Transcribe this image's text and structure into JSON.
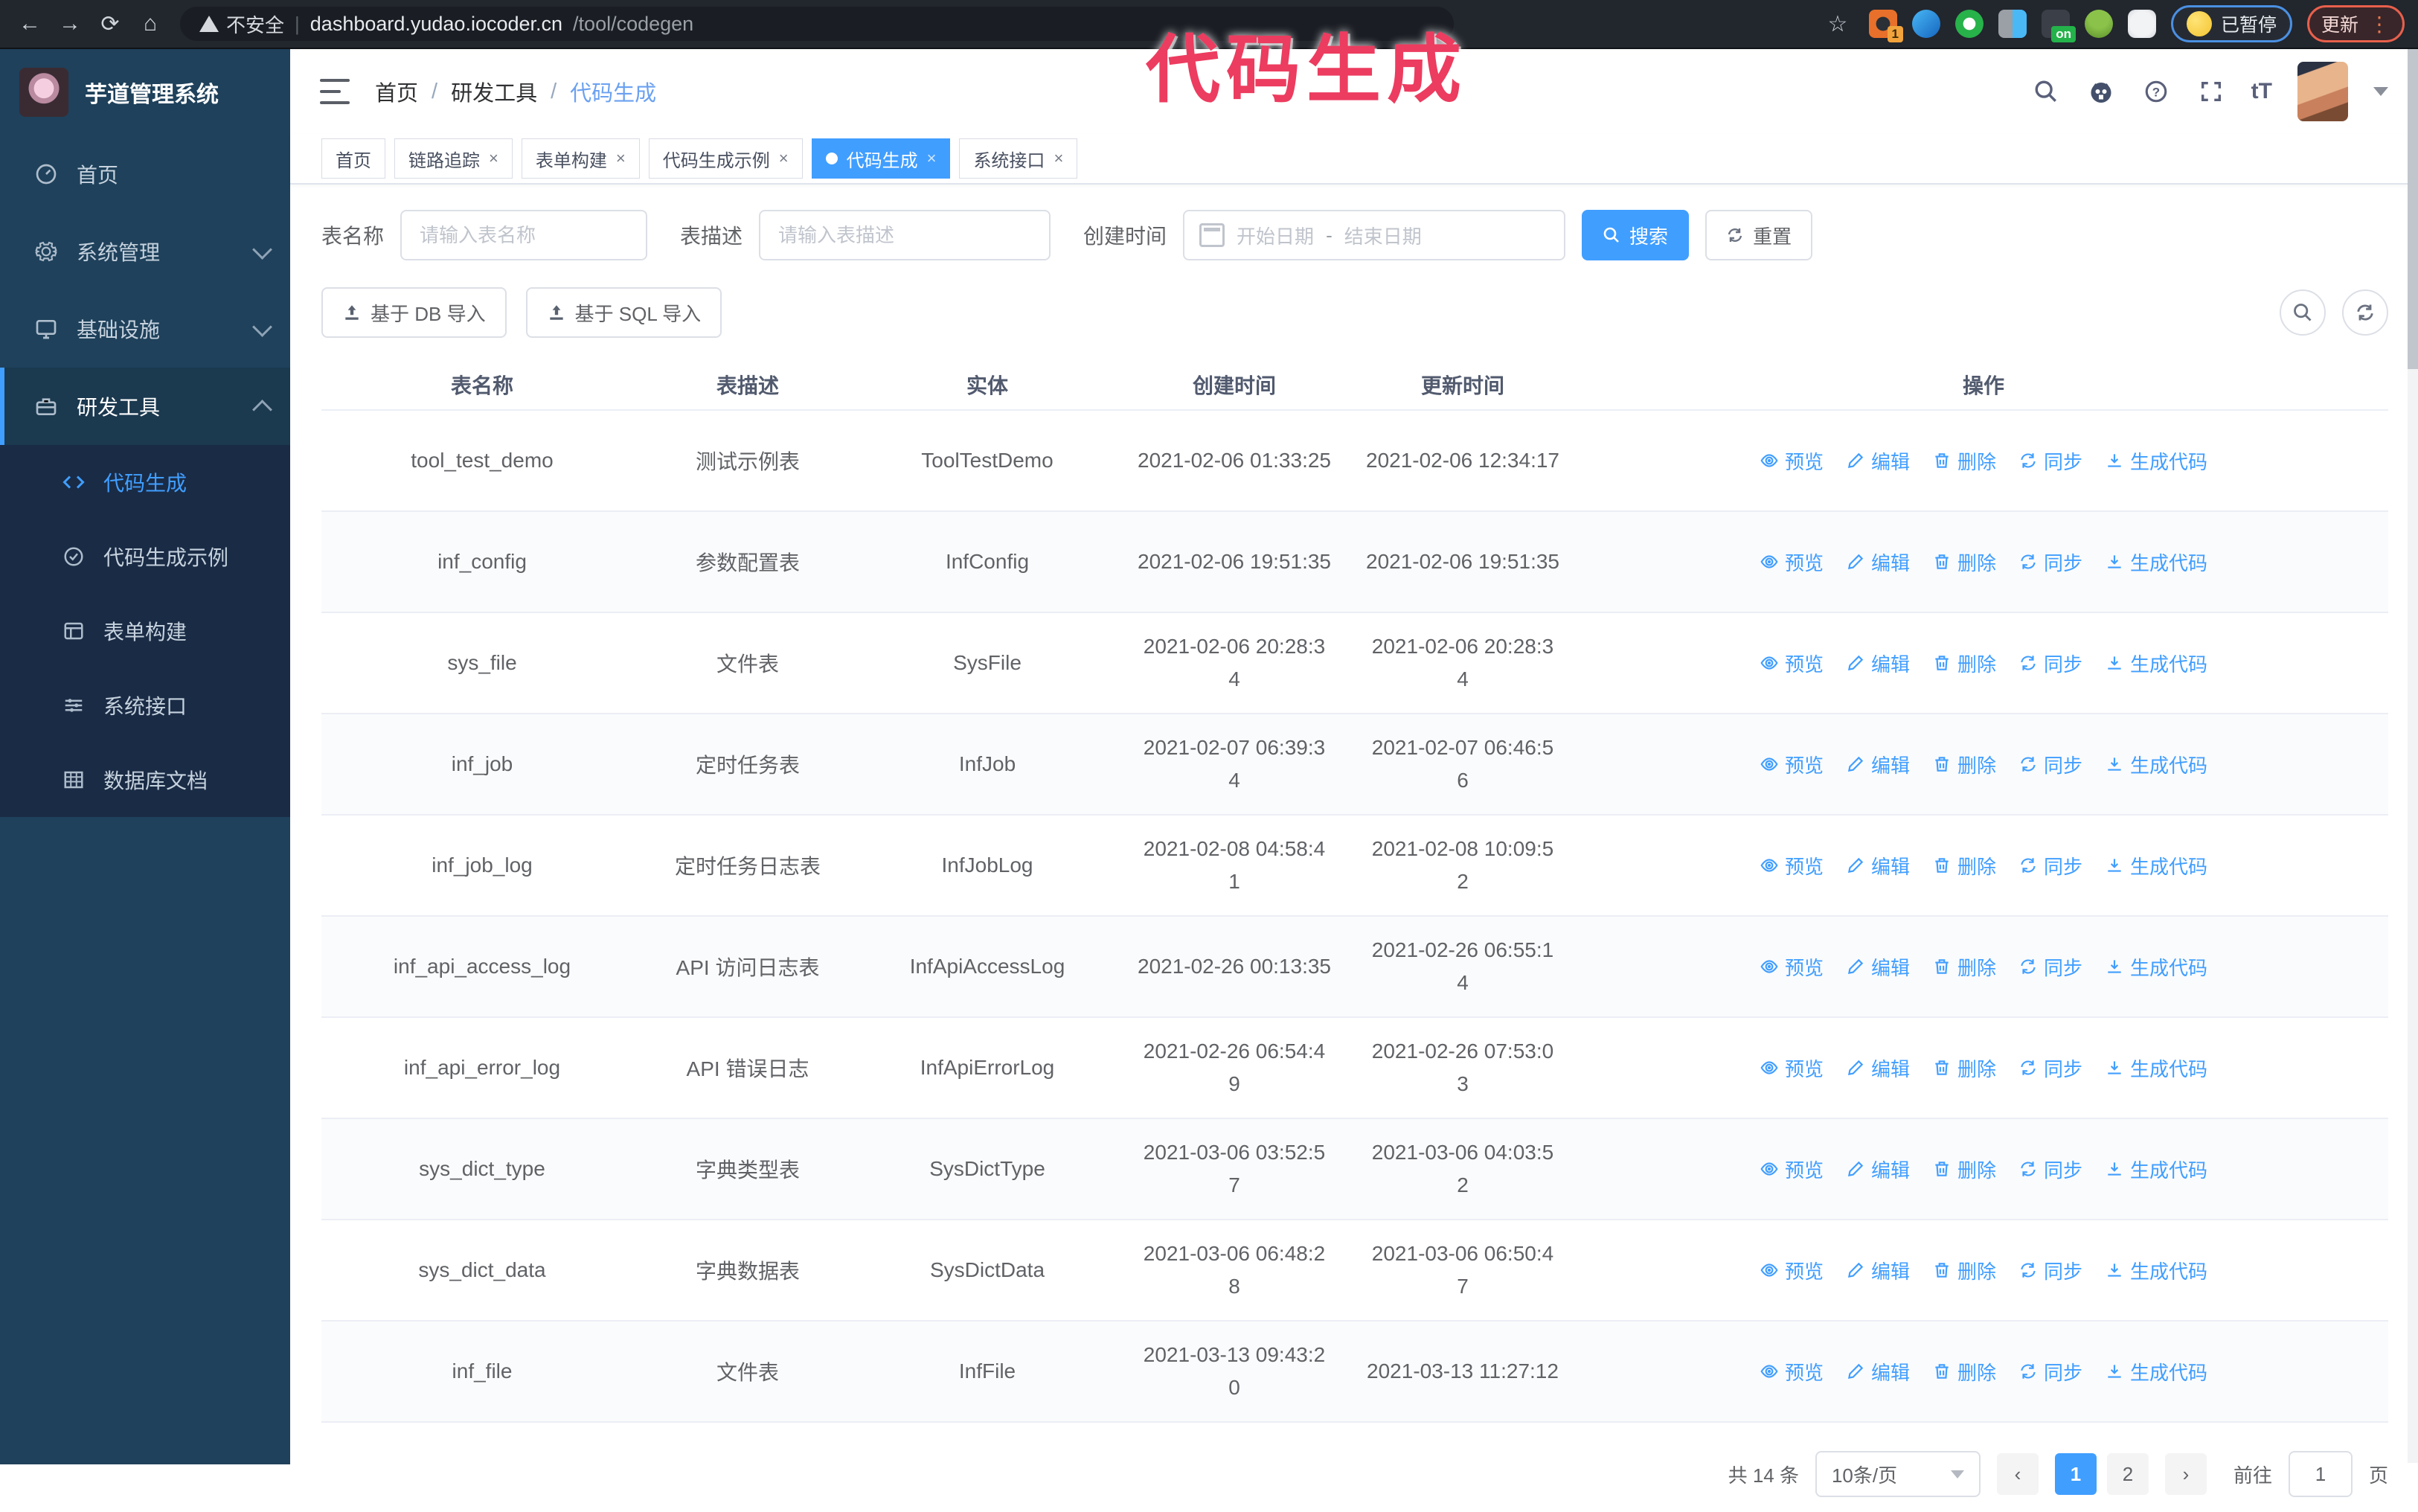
{
  "browser": {
    "security_label": "不安全",
    "url_host": "dashboard.yudao.iocoder.cn",
    "url_path": "/tool/codegen",
    "extension_badge": "1",
    "extension_on_badge": "on",
    "paused_chip": "已暂停",
    "update_button": "更新",
    "menu_dots": "⋮"
  },
  "watermark": "代码生成",
  "sidebar": {
    "app_title": "芋道管理系统",
    "items": [
      {
        "label": "首页",
        "icon": "dashboard-icon",
        "expandable": false,
        "active": false
      },
      {
        "label": "系统管理",
        "icon": "gear-icon",
        "expandable": true,
        "expanded": false,
        "active": false
      },
      {
        "label": "基础设施",
        "icon": "monitor-icon",
        "expandable": true,
        "expanded": false,
        "active": false
      },
      {
        "label": "研发工具",
        "icon": "toolbox-icon",
        "expandable": true,
        "expanded": true,
        "active": true
      }
    ],
    "submenu": [
      {
        "label": "代码生成",
        "icon": "code-icon",
        "active": true
      },
      {
        "label": "代码生成示例",
        "icon": "example-icon",
        "active": false
      },
      {
        "label": "表单构建",
        "icon": "form-icon",
        "active": false
      },
      {
        "label": "系统接口",
        "icon": "api-icon",
        "active": false
      },
      {
        "label": "数据库文档",
        "icon": "database-doc-icon",
        "active": false
      }
    ]
  },
  "header": {
    "breadcrumb": [
      "首页",
      "研发工具",
      "代码生成"
    ],
    "right_icons": [
      "search-icon",
      "github-icon",
      "help-icon",
      "fullscreen-icon",
      "text-size-icon",
      "avatar",
      "dropdown-caret"
    ]
  },
  "tabs": [
    {
      "label": "首页",
      "active": false,
      "closable": false
    },
    {
      "label": "链路追踪",
      "active": false,
      "closable": true
    },
    {
      "label": "表单构建",
      "active": false,
      "closable": true
    },
    {
      "label": "代码生成示例",
      "active": false,
      "closable": true
    },
    {
      "label": "代码生成",
      "active": true,
      "closable": true
    },
    {
      "label": "系统接口",
      "active": false,
      "closable": true
    }
  ],
  "filters": {
    "table_name_label": "表名称",
    "table_name_placeholder": "请输入表名称",
    "table_desc_label": "表描述",
    "table_desc_placeholder": "请输入表描述",
    "create_time_label": "创建时间",
    "start_placeholder": "开始日期",
    "range_separator": "-",
    "end_placeholder": "结束日期",
    "search_label": "搜索",
    "reset_label": "重置"
  },
  "toolbar": {
    "import_db_label": "基于 DB 导入",
    "import_sql_label": "基于 SQL 导入"
  },
  "table": {
    "columns": [
      "表名称",
      "表描述",
      "实体",
      "创建时间",
      "更新时间",
      "操作"
    ],
    "actions": [
      "预览",
      "编辑",
      "删除",
      "同步",
      "生成代码"
    ],
    "rows": [
      {
        "name": "tool_test_demo",
        "desc": "测试示例表",
        "entity": "ToolTestDemo",
        "created": "2021-02-06 01:33:25",
        "updated": "2021-02-06 12:34:17"
      },
      {
        "name": "inf_config",
        "desc": "参数配置表",
        "entity": "InfConfig",
        "created": "2021-02-06 19:51:35",
        "updated": "2021-02-06 19:51:35"
      },
      {
        "name": "sys_file",
        "desc": "文件表",
        "entity": "SysFile",
        "created": "2021-02-06 20:28:3\n4",
        "updated": "2021-02-06 20:28:3\n4"
      },
      {
        "name": "inf_job",
        "desc": "定时任务表",
        "entity": "InfJob",
        "created": "2021-02-07 06:39:3\n4",
        "updated": "2021-02-07 06:46:5\n6"
      },
      {
        "name": "inf_job_log",
        "desc": "定时任务日志表",
        "entity": "InfJobLog",
        "created": "2021-02-08 04:58:4\n1",
        "updated": "2021-02-08 10:09:5\n2"
      },
      {
        "name": "inf_api_access_log",
        "desc": "API 访问日志表",
        "entity": "InfApiAccessLog",
        "created": "2021-02-26 00:13:35",
        "updated": "2021-02-26 06:55:1\n4"
      },
      {
        "name": "inf_api_error_log",
        "desc": "API 错误日志",
        "entity": "InfApiErrorLog",
        "created": "2021-02-26 06:54:4\n9",
        "updated": "2021-02-26 07:53:0\n3"
      },
      {
        "name": "sys_dict_type",
        "desc": "字典类型表",
        "entity": "SysDictType",
        "created": "2021-03-06 03:52:5\n7",
        "updated": "2021-03-06 04:03:5\n2"
      },
      {
        "name": "sys_dict_data",
        "desc": "字典数据表",
        "entity": "SysDictData",
        "created": "2021-03-06 06:48:2\n8",
        "updated": "2021-03-06 06:50:4\n7"
      },
      {
        "name": "inf_file",
        "desc": "文件表",
        "entity": "InfFile",
        "created": "2021-03-13 09:43:2\n0",
        "updated": "2021-03-13 11:27:12"
      }
    ]
  },
  "pagination": {
    "total": "共 14 条",
    "page_size": "10条/页",
    "pages": [
      "1",
      "2"
    ],
    "active_page": "1",
    "goto_label": "前往",
    "goto_value": "1",
    "goto_suffix": "页"
  },
  "colors": {
    "accent": "#409eff",
    "watermark": "#ec3c5f",
    "sidebar_bg": "#1f415b",
    "submenu_bg": "#1a2b45"
  }
}
